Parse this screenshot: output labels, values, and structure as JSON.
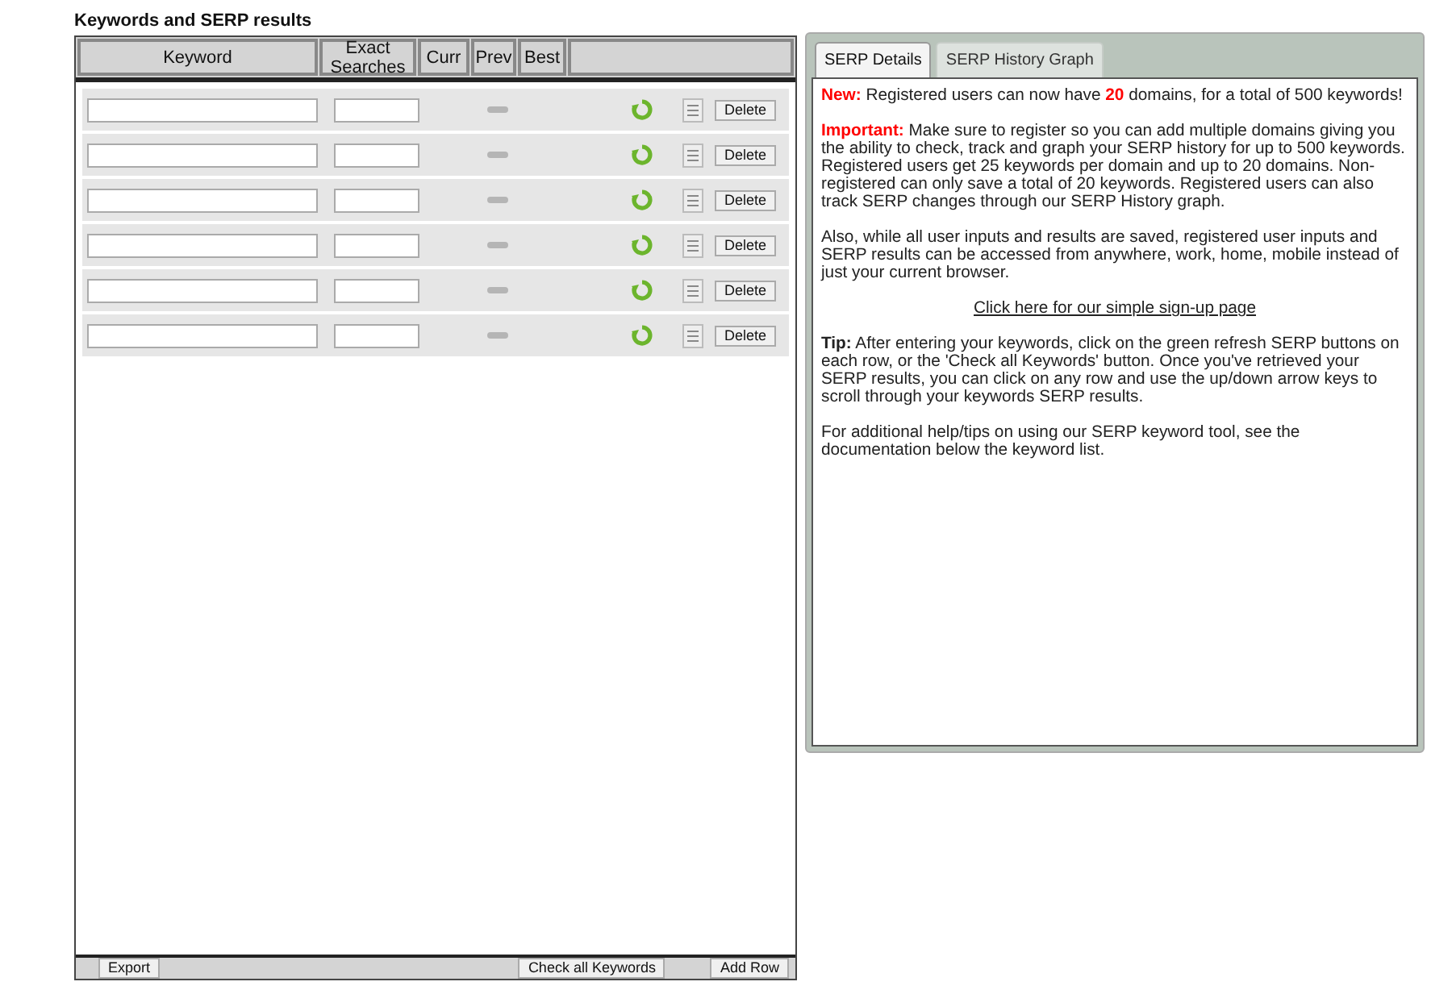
{
  "title": "Keywords and SERP results",
  "table": {
    "columns": [
      "Keyword",
      "Exact Searches",
      "Curr",
      "Prev",
      "Best"
    ],
    "rows": [
      {
        "action": "Delete"
      },
      {
        "action": "Delete"
      },
      {
        "action": "Delete"
      },
      {
        "action": "Delete"
      },
      {
        "action": "Delete"
      },
      {
        "action": "Delete"
      }
    ],
    "footer": {
      "export": "Export",
      "check_all": "Check all Keywords",
      "add_row": "Add Row"
    }
  },
  "panel": {
    "tabs": [
      {
        "label": "SERP Details",
        "selected": true
      },
      {
        "label": "SERP History Graph",
        "selected": false
      }
    ],
    "paragraphs": [
      {
        "kind": "text",
        "segments": [
          {
            "kind": "alert",
            "text": "New:"
          },
          {
            "kind": "plain",
            "text": " Registered users can now have "
          },
          {
            "kind": "alert",
            "text": "20"
          },
          {
            "kind": "plain",
            "text": " domains, for a total of 500 keywords!"
          }
        ]
      },
      {
        "kind": "text",
        "segments": [
          {
            "kind": "alert",
            "text": "Important:"
          },
          {
            "kind": "plain",
            "text": " Make sure to register so you can add multiple domains giving you the ability to check, track and graph your SERP history for up to 500 keywords. Registered users get 25 keywords per domain and up to 20 domains. Non-registered can only save a total of 20 keywords. Registered users can also track SERP changes through our SERP History graph."
          }
        ]
      },
      {
        "kind": "text",
        "segments": [
          {
            "kind": "plain",
            "text": "Also, while all user inputs and results are saved, registered user inputs and SERP results can be accessed from anywhere, work, home, mobile instead of just your current browser."
          }
        ]
      },
      {
        "kind": "link",
        "segments": [
          {
            "kind": "plain",
            "text": "Click here for our simple sign-up page"
          }
        ]
      },
      {
        "kind": "text",
        "segments": [
          {
            "kind": "bold",
            "text": "Tip:"
          },
          {
            "kind": "plain",
            "text": " After entering your keywords, click on the green refresh SERP buttons on each row, or the 'Check all Keywords' button. Once you've retrieved your SERP results, you can click on any row and use the up/down arrow keys to scroll through your keywords SERP results."
          }
        ]
      },
      {
        "kind": "text",
        "segments": [
          {
            "kind": "plain",
            "text": "For additional help/tips on using our SERP keyword tool, see the documentation below the keyword list."
          }
        ]
      }
    ]
  }
}
